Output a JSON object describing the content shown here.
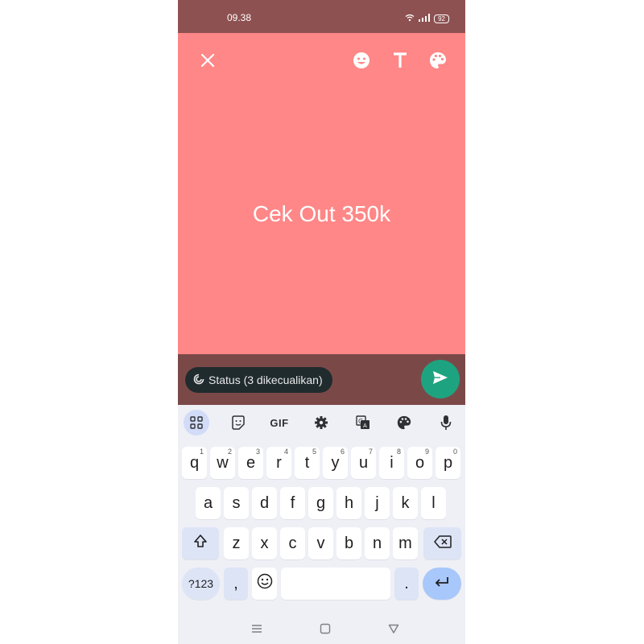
{
  "status_bar": {
    "time": "09.38",
    "battery": "92",
    "icons": [
      "wifi-icon",
      "signal-icon",
      "battery-icon"
    ]
  },
  "editor": {
    "toolbar": [
      "close-icon",
      "emoji-icon",
      "text-icon",
      "palette-icon"
    ],
    "status_text": "Cek Out 350k",
    "background_color": "#ff8787"
  },
  "footer": {
    "audience_label": "Status (3 dikecualikan)",
    "send_color": "#1ea380"
  },
  "keyboard": {
    "toolbar": {
      "gif_label": "GIF",
      "icons": [
        "apps-grid-icon",
        "sticker-icon",
        "gif-icon",
        "settings-gear-icon",
        "translate-icon",
        "palette-icon",
        "microphone-icon"
      ]
    },
    "row1": [
      {
        "key": "q",
        "hint": "1"
      },
      {
        "key": "w",
        "hint": "2"
      },
      {
        "key": "e",
        "hint": "3"
      },
      {
        "key": "r",
        "hint": "4"
      },
      {
        "key": "t",
        "hint": "5"
      },
      {
        "key": "y",
        "hint": "6"
      },
      {
        "key": "u",
        "hint": "7"
      },
      {
        "key": "i",
        "hint": "8"
      },
      {
        "key": "o",
        "hint": "9"
      },
      {
        "key": "p",
        "hint": "0"
      }
    ],
    "row2": [
      "a",
      "s",
      "d",
      "f",
      "g",
      "h",
      "j",
      "k",
      "l"
    ],
    "row3": [
      "z",
      "x",
      "c",
      "v",
      "b",
      "n",
      "m"
    ],
    "row4": {
      "symbols": "?123",
      "comma": ",",
      "period": "."
    }
  },
  "nav_bar": {
    "icons": [
      "menu-icon",
      "home-icon",
      "back-icon"
    ]
  }
}
